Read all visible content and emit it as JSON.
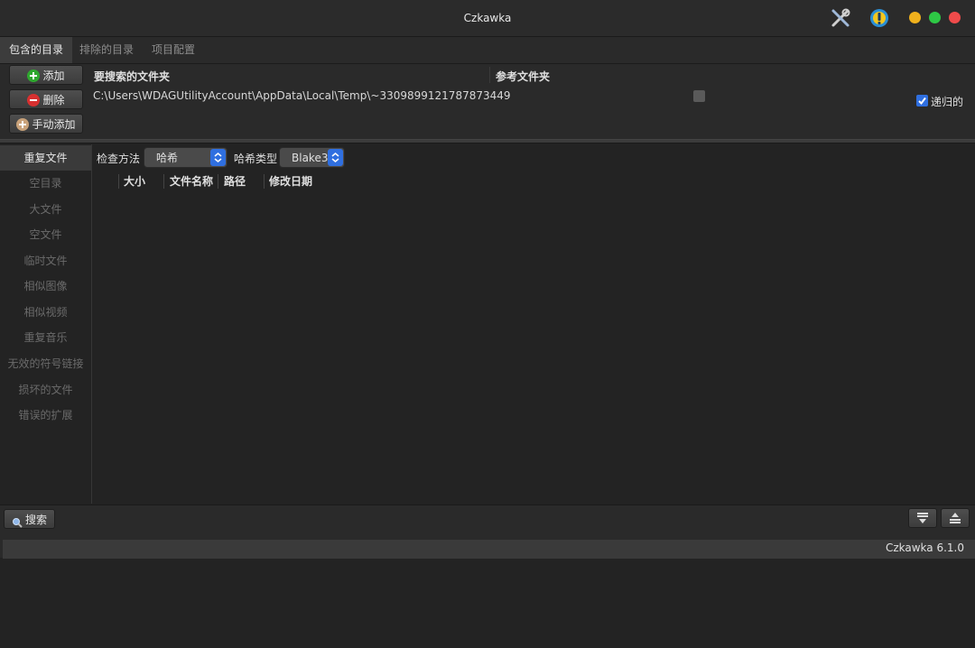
{
  "window": {
    "title": "Czkawka"
  },
  "tabs": [
    {
      "label": "包含的目录",
      "active": true
    },
    {
      "label": "排除的目录",
      "active": false
    },
    {
      "label": "项目配置",
      "active": false
    }
  ],
  "included_panel": {
    "buttons": {
      "add": "添加",
      "remove": "删除",
      "manual_add": "手动添加"
    },
    "columns": {
      "folders": "要搜索的文件夹",
      "reference": "参考文件夹"
    },
    "rows": [
      {
        "path": "C:\\Users\\WDAGUtilityAccount\\AppData\\Local\\Temp\\~3309899121787873449",
        "reference_checked": false
      }
    ],
    "recursive": {
      "label": "递归的",
      "checked": true
    }
  },
  "sidebar": {
    "items": [
      {
        "label": "重复文件",
        "active": true
      },
      {
        "label": "空目录"
      },
      {
        "label": "大文件"
      },
      {
        "label": "空文件"
      },
      {
        "label": "临时文件"
      },
      {
        "label": "相似图像"
      },
      {
        "label": "相似视频"
      },
      {
        "label": "重复音乐"
      },
      {
        "label": "无效的符号链接"
      },
      {
        "label": "损坏的文件"
      },
      {
        "label": "错误的扩展"
      }
    ]
  },
  "main": {
    "check_method_label": "检查方法",
    "check_method_value": "哈希",
    "hash_type_label": "哈希类型",
    "hash_type_value": "Blake3",
    "table_headers": [
      "大小",
      "文件名称",
      "路径",
      "修改日期"
    ]
  },
  "bottom": {
    "search_button": "搜索",
    "version": "Czkawka 6.1.0"
  },
  "colors": {
    "traffic_yellow": "#f0b11d",
    "traffic_green": "#2ec845",
    "traffic_red": "#ef4b4b",
    "accent_blue": "#2f6fe0"
  }
}
